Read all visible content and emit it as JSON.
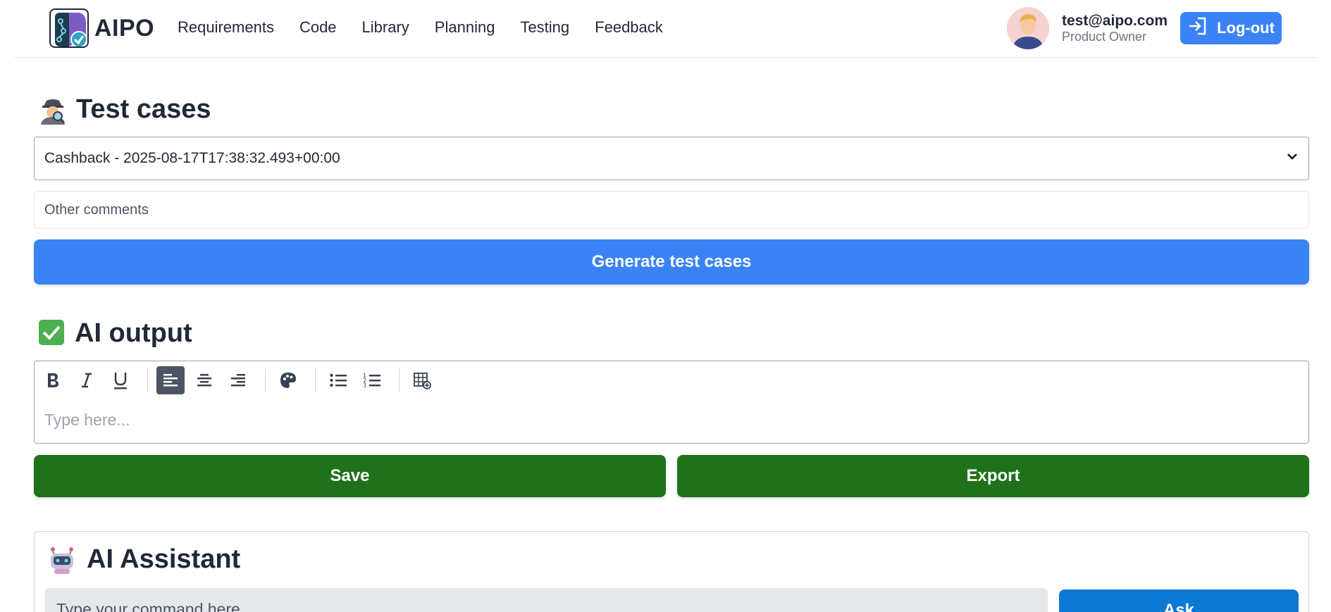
{
  "header": {
    "logo_text": "AIPO",
    "nav": [
      "Requirements",
      "Code",
      "Library",
      "Planning",
      "Testing",
      "Feedback"
    ],
    "user": {
      "email": "test@aipo.com",
      "role": "Product Owner",
      "logout_label": "Log-out"
    }
  },
  "test_cases": {
    "title": "Test cases",
    "selected_requirement": "Cashback - 2025-08-17T17:38:32.493+00:00",
    "comments_placeholder": "Other comments",
    "generate_label": "Generate test cases"
  },
  "ai_output": {
    "title": "AI output",
    "editor_placeholder": "Type here...",
    "toolbar": [
      "bold",
      "italic",
      "underline",
      "align-left",
      "align-center",
      "align-right",
      "color",
      "bullet-list",
      "numbered-list",
      "insert-table"
    ],
    "active_tool": "align-left",
    "save_label": "Save",
    "export_label": "Export"
  },
  "assistant": {
    "title": "AI Assistant",
    "input_placeholder": "Type your command here",
    "ask_label": "Ask"
  },
  "colors": {
    "primary_blue": "#3b82f6",
    "ask_blue": "#0b78d4",
    "green": "#1f7219",
    "text": "#1f2937"
  }
}
